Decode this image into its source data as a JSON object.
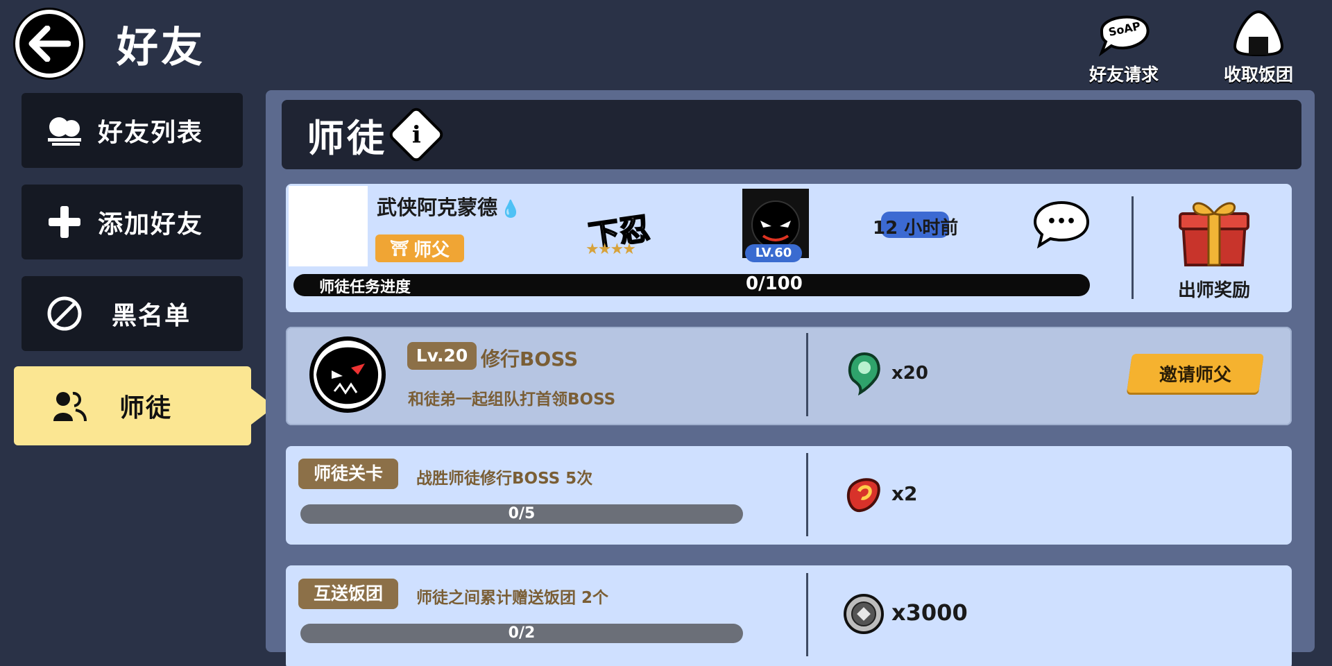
{
  "header": {
    "title": "好友",
    "actions": [
      {
        "label": "好友请求",
        "icon": "soap-bubble-icon",
        "bubble_text": "SoAP"
      },
      {
        "label": "收取饭团",
        "icon": "rice-ball-icon"
      }
    ]
  },
  "sidebar": {
    "items": [
      {
        "label": "好友列表",
        "icon": "friends-list-icon",
        "active": false
      },
      {
        "label": "添加好友",
        "icon": "plus-icon",
        "active": false
      },
      {
        "label": "黑名单",
        "icon": "block-icon",
        "active": false
      },
      {
        "label": "师徒",
        "icon": "mentor-icon",
        "active": true
      }
    ],
    "active_color": "#fbe692"
  },
  "section": {
    "title": "师徒",
    "info_symbol": "i"
  },
  "master": {
    "name": "武侠阿克蒙德",
    "name_suffix_icon": "water-drop-icon",
    "name_suffix_glyph": "💧",
    "role_tag": "师父",
    "role_tag_glyph": "⛩",
    "rank_text": "下忍",
    "rank_stars": "★★★★",
    "level": "LV.60",
    "last_seen": "12 小时前",
    "chat_glyph": "•••",
    "progress_label": "师徒任务进度",
    "progress_value": "0/100",
    "progress_fraction": 0,
    "graduation_reward_label": "出师奖励"
  },
  "boss": {
    "level": "Lv.20",
    "title": "修行BOSS",
    "description": "和徒弟一起组队打首领BOSS",
    "reward_icon": "green-spirit-orb-icon",
    "reward_qty": "x20",
    "invite_label": "邀请师父"
  },
  "tasks": [
    {
      "tag": "师徒关卡",
      "description": "战胜师徒修行BOSS 5次",
      "progress": "0/5",
      "progress_fraction": 0,
      "reward_icon": "red-scroll-gem-icon",
      "reward_qty": "x2"
    },
    {
      "tag": "互送饭团",
      "description": "师徒之间累计赠送饭团 2个",
      "progress": "0/2",
      "progress_fraction": 0,
      "reward_icon": "silver-coin-icon",
      "reward_qty": "x3000"
    }
  ],
  "colors": {
    "background": "#2a3247",
    "panel": "#5c6a8e",
    "card": "#cfe0ff",
    "tag_brown": "#8c7048",
    "accent_orange": "#f5b22f",
    "level_blue": "#3a6bd0"
  }
}
